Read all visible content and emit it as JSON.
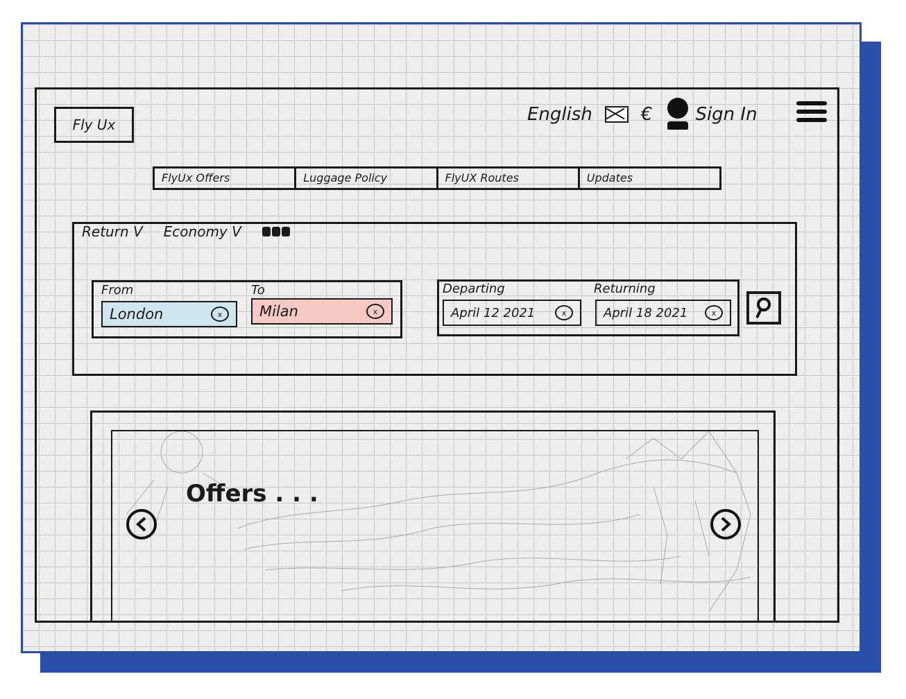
{
  "colors": {
    "border_blue": "#2a4fa8",
    "from_field": "#cfe6ee",
    "to_field": "#f4c9c3"
  },
  "header": {
    "logo": "Fly Ux",
    "language": "English",
    "currency": "€",
    "sign_in": "Sign In"
  },
  "nav": {
    "tabs": [
      "FlyUx Offers",
      "Luggage Policy",
      "FlyUX Routes",
      "Updates"
    ]
  },
  "search": {
    "trip_type": "Return V",
    "cabin_class": "Economy V",
    "from_label": "From",
    "from_value": "London",
    "to_label": "To",
    "to_value": "Milan",
    "departing_label": "Departing",
    "departing_value": "April 12 2021",
    "returning_label": "Returning",
    "returning_value": "April 18 2021",
    "clear_glyph": "x"
  },
  "carousel": {
    "title": "Offers . . ."
  }
}
